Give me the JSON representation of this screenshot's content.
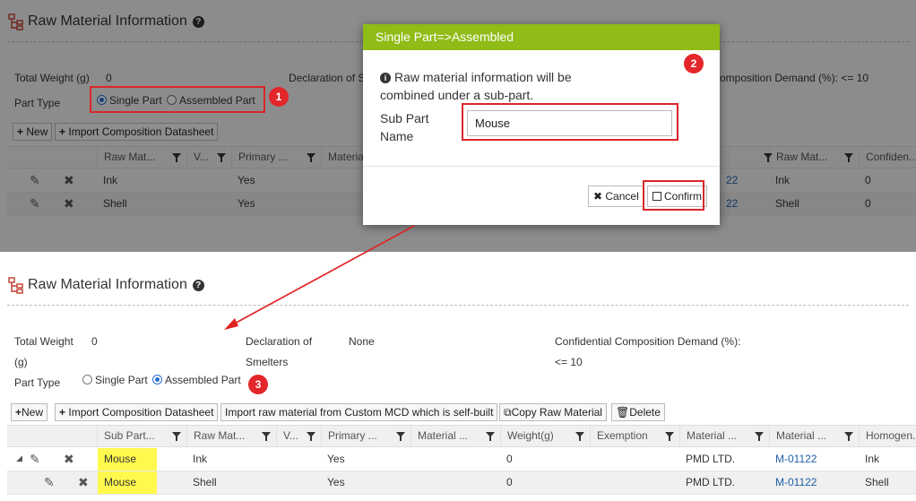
{
  "section": {
    "title": "Raw Material Information"
  },
  "top": {
    "total_weight_label": "Total Weight (g)",
    "total_weight_value": "0",
    "declaration_label": "Declaration of S",
    "comp_demand_label": "omposition Demand (%): <= 10",
    "part_type_label": "Part Type",
    "single_part": "Single Part",
    "assembled_part": "Assembled Part",
    "btn_new": "New",
    "btn_import": "Import Composition Datasheet",
    "headers": [
      "Raw Mat...",
      "V...",
      "Primary ...",
      "Materia",
      "Raw Mat...",
      "Confiden..."
    ],
    "rows": [
      {
        "raw": "Ink",
        "primary": "Yes",
        "link_tail": "22",
        "raw2": "Ink",
        "conf": "0"
      },
      {
        "raw": "Shell",
        "primary": "Yes",
        "link_tail": "22",
        "raw2": "Shell",
        "conf": "0"
      }
    ]
  },
  "dialog": {
    "title": "Single Part=>Assembled",
    "message": "Raw material information will be combined under a sub-part.",
    "field_label": "Sub Part Name",
    "field_value": "Mouse",
    "cancel": "Cancel",
    "confirm": "Confirm"
  },
  "bottom": {
    "total_weight_label_1": "Total Weight",
    "total_weight_label_2": "(g)",
    "total_weight_value": "0",
    "declaration_label_1": "Declaration of",
    "declaration_label_2": "Smelters",
    "declaration_value": "None",
    "comp_demand_label": "Confidential Composition Demand (%):",
    "comp_demand_value": "<= 10",
    "part_type_label": "Part Type",
    "single_part": "Single Part",
    "assembled_part": "Assembled Part",
    "btn_new": "New",
    "btn_import": "Import Composition Datasheet",
    "btn_import_custom": "Import raw material from Custom MCD which is self-built",
    "btn_copy": "Copy Raw Material",
    "btn_delete": "Delete",
    "headers": [
      "Sub Part...",
      "Raw Mat...",
      "V...",
      "Primary ...",
      "Material ...",
      "Weight(g)",
      "Exemption",
      "Material ...",
      "Material ...",
      "Homogen..."
    ],
    "rows": [
      {
        "sub": "Mouse",
        "raw": "Ink",
        "primary": "Yes",
        "weight": "0",
        "supplier": "PMD LTD.",
        "number": "M-01122",
        "homog": "Ink"
      },
      {
        "sub": "Mouse",
        "raw": "Shell",
        "primary": "Yes",
        "weight": "0",
        "supplier": "PMD LTD.",
        "number": "M-01122",
        "homog": "Shell"
      }
    ]
  },
  "badges": [
    "1",
    "2",
    "3"
  ],
  "colors": {
    "dialog_header": "#8fbc17",
    "annotation_red": "#d9262a",
    "highlight": "#fff94d",
    "link": "#1f5fa8"
  }
}
